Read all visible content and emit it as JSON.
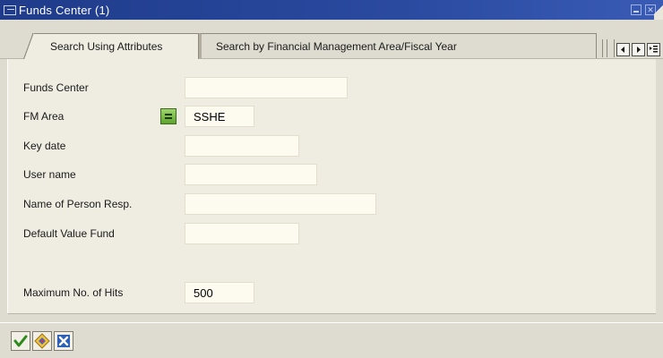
{
  "window": {
    "title": "Funds Center (1)"
  },
  "tabs": [
    {
      "label": "Search Using Attributes",
      "active": true
    },
    {
      "label": "Search by Financial Management Area/Fiscal Year",
      "active": false
    }
  ],
  "form": {
    "fields": [
      {
        "label": "Funds Center",
        "value": ""
      },
      {
        "label": "FM Area",
        "value": "SSHE",
        "operator": "equals"
      },
      {
        "label": "Key date",
        "value": ""
      },
      {
        "label": "User name",
        "value": ""
      },
      {
        "label": "Name of Person Resp.",
        "value": ""
      },
      {
        "label": "Default Value Fund",
        "value": ""
      },
      {
        "label": "Maximum No. of Hits",
        "value": "500"
      }
    ]
  },
  "toolbar": {
    "buttons": [
      {
        "icon": "checkmark-icon",
        "action": "continue"
      },
      {
        "icon": "search-icon",
        "action": "start-search"
      },
      {
        "icon": "cancel-x-icon",
        "action": "cancel"
      }
    ]
  },
  "colors": {
    "titlebar": "#1f3b8a",
    "panel_bg": "#efece2",
    "field_bg": "#fdfbf0",
    "operator_green": "#5ea42e"
  }
}
